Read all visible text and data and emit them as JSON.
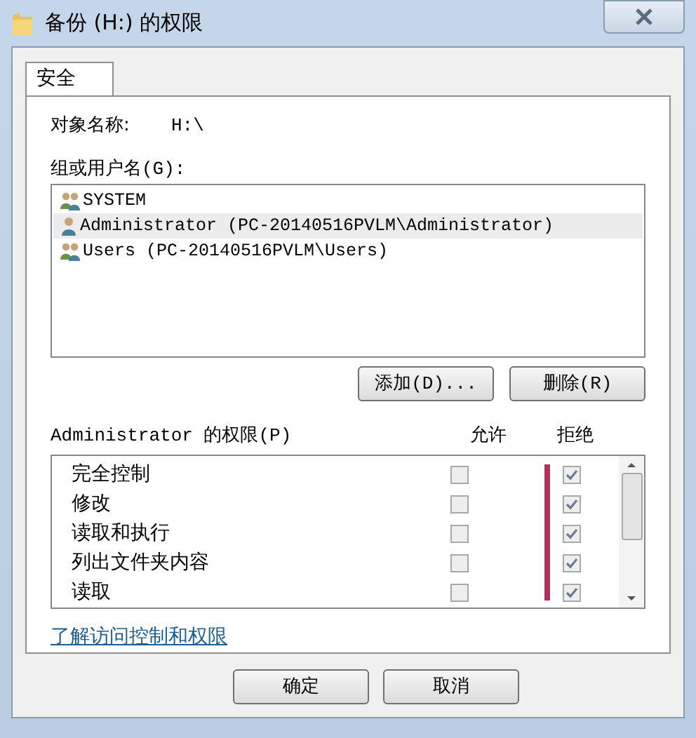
{
  "window": {
    "title": "备份 (H:) 的权限"
  },
  "tabs": [
    {
      "label": "安全",
      "selected": true
    }
  ],
  "object_name": {
    "label": "对象名称:",
    "value": "H:\\"
  },
  "groups": {
    "label": "组或用户名(G):",
    "items": [
      {
        "name": "SYSTEM",
        "kind": "group",
        "selected": false
      },
      {
        "name": "Administrator (PC-20140516PVLM\\Administrator)",
        "kind": "user",
        "selected": true
      },
      {
        "name": "Users (PC-20140516PVLM\\Users)",
        "kind": "group",
        "selected": false
      }
    ]
  },
  "group_buttons": [
    "添加(D)...",
    "删除(R)"
  ],
  "permissions": {
    "label": "Administrator 的权限(P)",
    "allow_header": "允许",
    "deny_header": "拒绝",
    "rows": [
      {
        "name": "完全控制",
        "allow": false,
        "deny": true
      },
      {
        "name": "修改",
        "allow": false,
        "deny": true
      },
      {
        "name": "读取和执行",
        "allow": false,
        "deny": true
      },
      {
        "name": "列出文件夹内容",
        "allow": false,
        "deny": true
      },
      {
        "name": "读取",
        "allow": false,
        "deny": true
      }
    ]
  },
  "link": "了解访问控制和权限",
  "buttons": [
    "确定",
    "取消"
  ]
}
